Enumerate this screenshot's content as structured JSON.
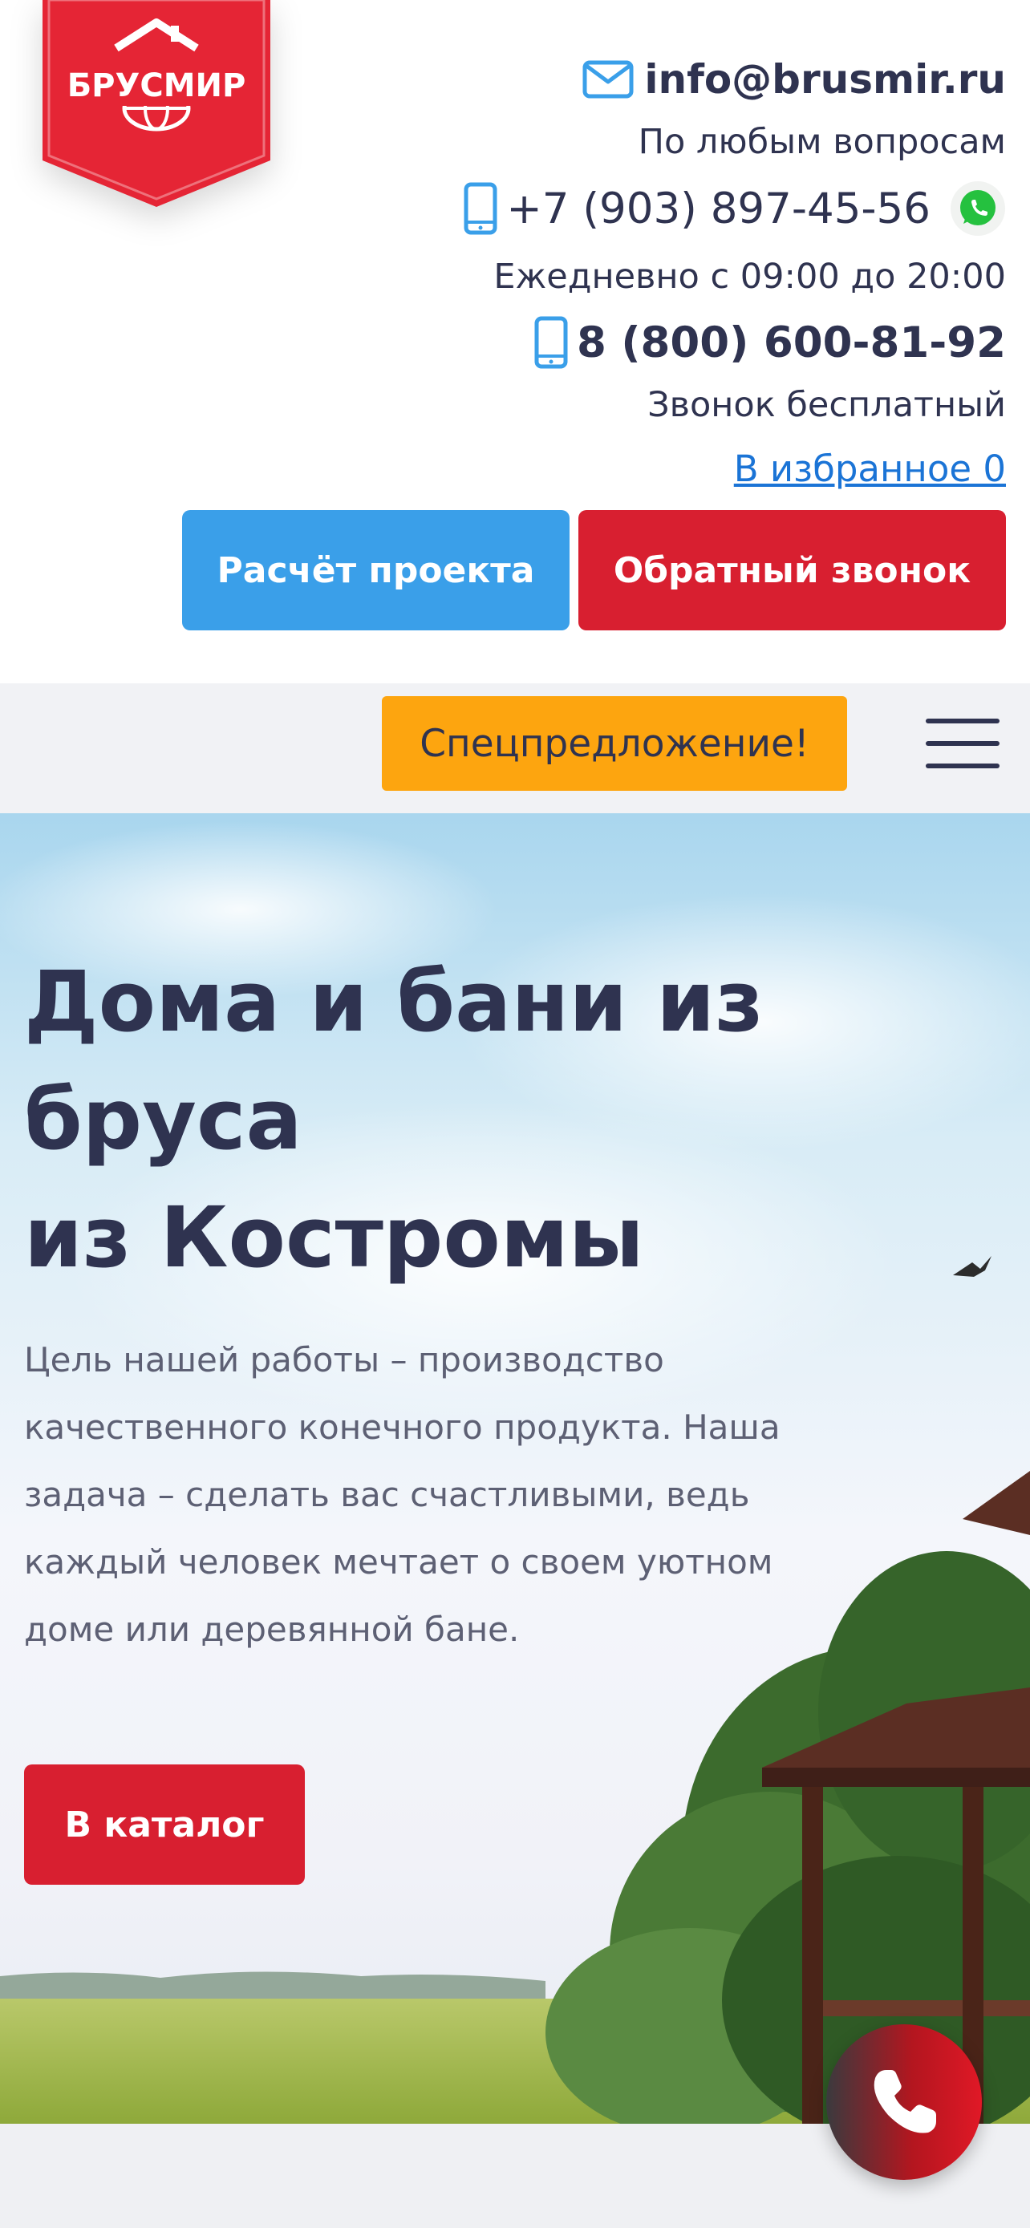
{
  "header": {
    "logo_text": "БРУСМИР",
    "email": "info@brusmir.ru",
    "any_questions": "По любым вопросам",
    "phone_main": "+7 (903) 897-45-56",
    "hours": "Ежедневно с 09:00 до 20:00",
    "phone_free": "8 (800) 600-81-92",
    "free_call": "Звонок бесплатный",
    "favorites_link": "В избранное 0",
    "calc_button": "Расчёт проекта",
    "callback_button": "Обратный звонок"
  },
  "nav": {
    "special_button": "Спецпредложение!"
  },
  "hero": {
    "title_lines": [
      "Дома и бани из",
      "бруса",
      "из Костромы"
    ],
    "desc_lines": [
      "Цель нашей работы – производство",
      "качественного конечного продукта. Наша",
      "задача – сделать вас счастливыми, ведь",
      "каждый человек мечтает о своем уютном",
      "доме или деревянной бане."
    ],
    "catalog_button": "В каталог"
  },
  "icons": {
    "email": "mail-icon",
    "phone": "mobile-phone-icon",
    "whatsapp": "whatsapp-icon",
    "menu": "hamburger-menu-icon",
    "call": "phone-handset-icon"
  },
  "colors": {
    "brand_red": "#d81f30",
    "accent_blue": "#3a9fe9",
    "special_orange": "#fda50f",
    "text_dark": "#2f3350",
    "link_blue": "#1b74d6",
    "whatsapp_green": "#25c13f"
  }
}
